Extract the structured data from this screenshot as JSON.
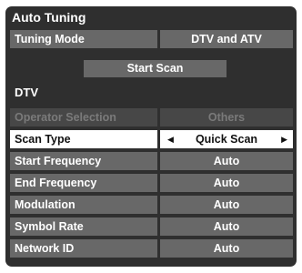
{
  "menu": {
    "title": "Auto Tuning",
    "tuning_mode": {
      "label": "Tuning Mode",
      "value": "DTV and ATV"
    },
    "start_scan": "Start Scan",
    "section": "DTV",
    "rows": [
      {
        "label": "Operator Selection",
        "value": "Others",
        "state": "disabled"
      },
      {
        "label": "Scan Type",
        "value": "Quick Scan",
        "state": "selected"
      },
      {
        "label": "Start Frequency",
        "value": "Auto",
        "state": "normal"
      },
      {
        "label": "End Frequency",
        "value": "Auto",
        "state": "normal"
      },
      {
        "label": "Modulation",
        "value": "Auto",
        "state": "normal"
      },
      {
        "label": "Symbol Rate",
        "value": "Auto",
        "state": "normal"
      },
      {
        "label": "Network ID",
        "value": "Auto",
        "state": "normal"
      }
    ]
  },
  "icons": {
    "left_arrow": "triangle-left-icon",
    "right_arrow": "triangle-right-icon"
  },
  "colors": {
    "panel_bg": "#2f2f2f",
    "row_bg": "#686868",
    "selected_bg": "#ffffff",
    "disabled_text": "#7a7a7a"
  }
}
